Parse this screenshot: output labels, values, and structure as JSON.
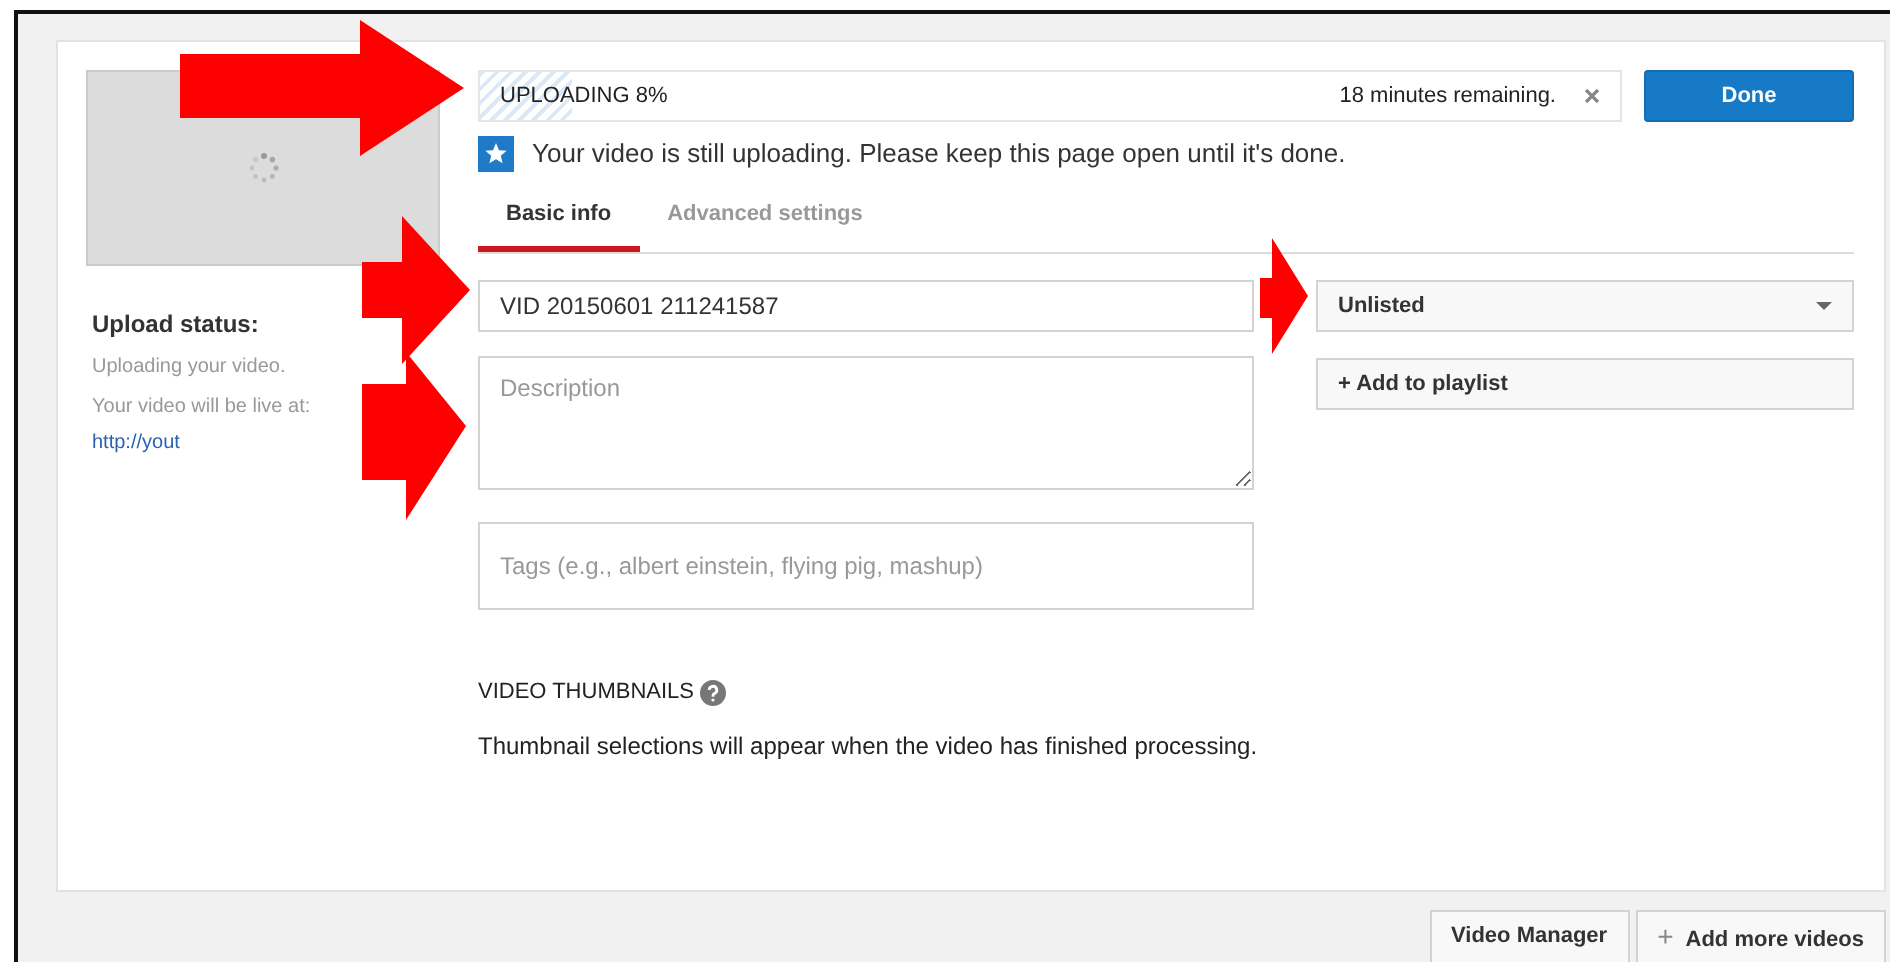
{
  "upload_status": {
    "heading": "Upload status:",
    "message": "Uploading your video.",
    "live_label": "Your video will be live at:",
    "link": "http://yout"
  },
  "progress": {
    "label": "UPLOADING 8%",
    "level": 0.08,
    "remaining": "18 minutes remaining."
  },
  "done_button": "Done",
  "notice": "Your video is still uploading. Please keep this page open until it's done.",
  "tabs": [
    {
      "label": "Basic info",
      "selected": true
    },
    {
      "label": "Advanced settings",
      "selected": false
    }
  ],
  "title_field": {
    "value": "VID 20150601 211241587"
  },
  "description_field": {
    "placeholder": "Description"
  },
  "tags_field": {
    "placeholder": "Tags (e.g., albert einstein, flying pig, mashup)"
  },
  "privacy": {
    "value": "Unlisted"
  },
  "playlist_button": "+ Add to playlist",
  "thumbnails": {
    "heading": "VIDEO THUMBNAILS",
    "message": "Thumbnail selections will appear when the video has finished processing."
  },
  "footer_buttons": [
    {
      "label": "Video Manager"
    },
    {
      "icon": "+",
      "label": "Add more videos"
    }
  ]
}
